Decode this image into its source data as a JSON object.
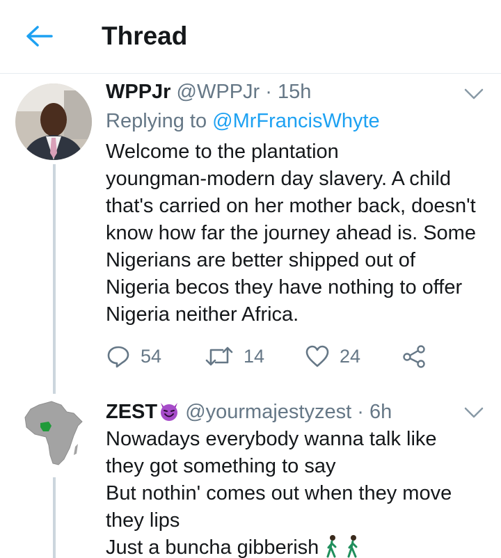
{
  "header": {
    "title": "Thread",
    "accent_color": "#1da1f2"
  },
  "tweets": [
    {
      "name": "WPPJr",
      "handle": "@WPPJr",
      "time": "15h",
      "reply_prefix": "Replying to",
      "reply_to": "@MrFrancisWhyte",
      "text_lines": [
        "Welcome to the plantation",
        "youngman-modern day slavery. A child",
        "that's carried on her mother back, doesn't",
        "know how far the journey ahead is. Some",
        "Nigerians are better shipped out of",
        "Nigeria becos they have nothing to offer",
        "Nigeria neither Africa."
      ],
      "replies": "54",
      "retweets": "14",
      "likes": "24"
    },
    {
      "name": "ZEST",
      "name_emoji": "smiling-devil",
      "handle": "@yourmajestyzest",
      "time": "6h",
      "text_lines": [
        "Nowadays everybody wanna talk like",
        "they got something to say",
        "But nothin' comes out when they move",
        "they lips",
        "Just a buncha gibberish"
      ],
      "trailing_emojis": [
        "person-walking",
        "person-walking"
      ]
    }
  ]
}
